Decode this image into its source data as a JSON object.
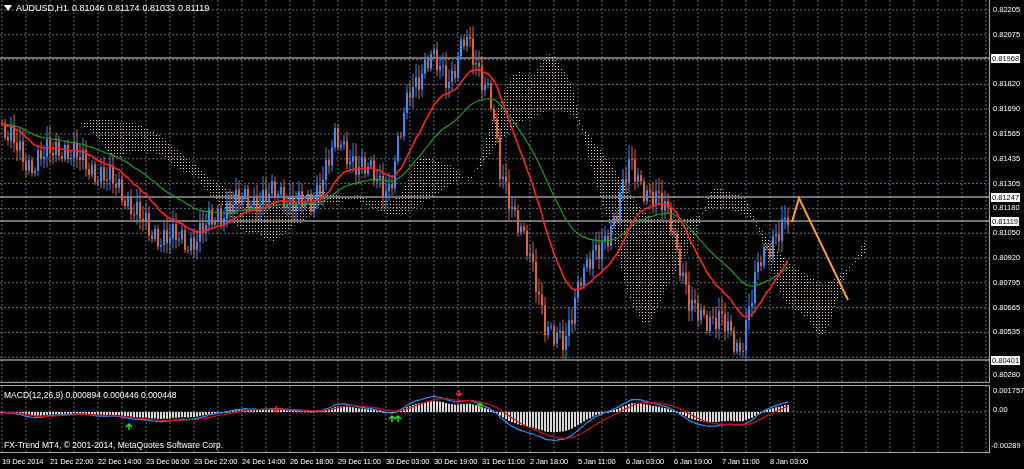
{
  "chart_header": {
    "symbol": "AUDUSD,H1",
    "quotes": [
      "0.81046",
      "0.81174",
      "0.81033",
      "0.81119"
    ]
  },
  "price_axis": {
    "ticks": [
      "0.82205",
      "0.82075",
      "0.81820",
      "0.81690",
      "0.81565",
      "0.81435",
      "0.81305",
      "0.81180",
      "0.81050",
      "0.80920",
      "0.80795",
      "0.80665",
      "0.80535",
      "0.80280"
    ],
    "price_levels": [
      "0.81968",
      "0.81247",
      "0.81119",
      "0.80401"
    ]
  },
  "macd_panel": {
    "label": "MACD(12,26,9) 0.000894 0.000446 0.000448",
    "copyright": "FX-Trend MT4, © 2001-2014, MetaQuotes Software Corp.",
    "ticks": [
      "0.001757",
      "0.00",
      "-0.00289"
    ]
  },
  "time_axis": [
    "19 Dec 2014",
    "21 Dec 22:00",
    "22 Dec 14:00",
    "23 Dec 06:00",
    "23 Dec 22:00",
    "24 Dec 14:00",
    "26 Dec 18:00",
    "29 Dec 11:00",
    "30 Dec 03:00",
    "30 Dec 19:00",
    "31 Dec 11:00",
    "2 Jan 18:00",
    "5 Jan 11:00",
    "6 Jan 03:00",
    "6 Jan 19:00",
    "7 Jan 11:00",
    "8 Jan 03:00"
  ]
}
